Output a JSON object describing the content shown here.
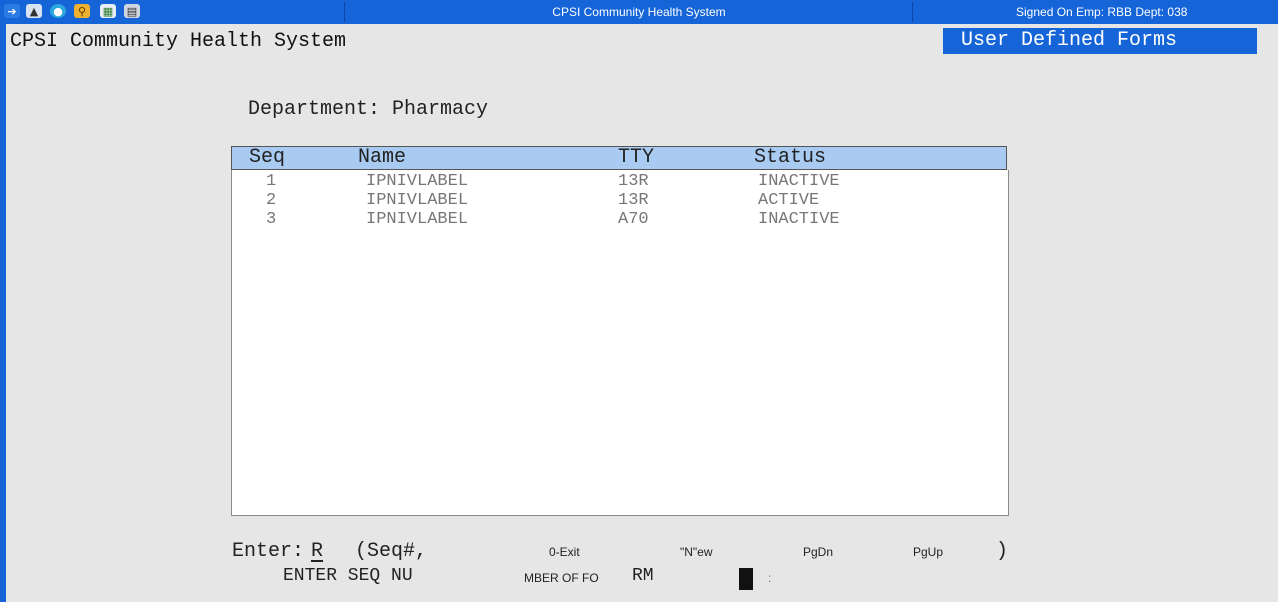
{
  "titlebar": {
    "title": "CPSI Community Health System",
    "status": "Signed On Emp: RBB  Dept: 038",
    "icons": [
      "back-arrow-icon",
      "car-icon",
      "eye-icon",
      "key-icon",
      "grid-icon",
      "report-icon"
    ]
  },
  "header": {
    "system_name": "CPSI Community Health System",
    "form_title": "User Defined Forms"
  },
  "department_label": "Department: Pharmacy",
  "grid": {
    "columns": [
      "Seq",
      "Name",
      "TTY",
      "Status"
    ],
    "rows": [
      {
        "seq": "1",
        "name": "IPNIVLABEL",
        "tty": "13R",
        "status": "INACTIVE"
      },
      {
        "seq": "2",
        "name": "IPNIVLABEL",
        "tty": "13R",
        "status": "ACTIVE"
      },
      {
        "seq": "3",
        "name": "IPNIVLABEL",
        "tty": "A70",
        "status": "INACTIVE"
      }
    ]
  },
  "prompt": {
    "enter_label": "Enter:",
    "enter_value": "R",
    "seq_label": "(Seq#,",
    "exit": "0-Exit",
    "new": "\"N\"ew",
    "pgdn": "PgDn",
    "pgup": "PgUp",
    "close_paren": ")",
    "help_part1": "ENTER SEQ NU",
    "help_part2": "MBER OF FO",
    "help_part3": "RM",
    "colon": ":"
  },
  "colors": {
    "accent": "#1565d8",
    "grid_header": "#a9cbf2"
  }
}
